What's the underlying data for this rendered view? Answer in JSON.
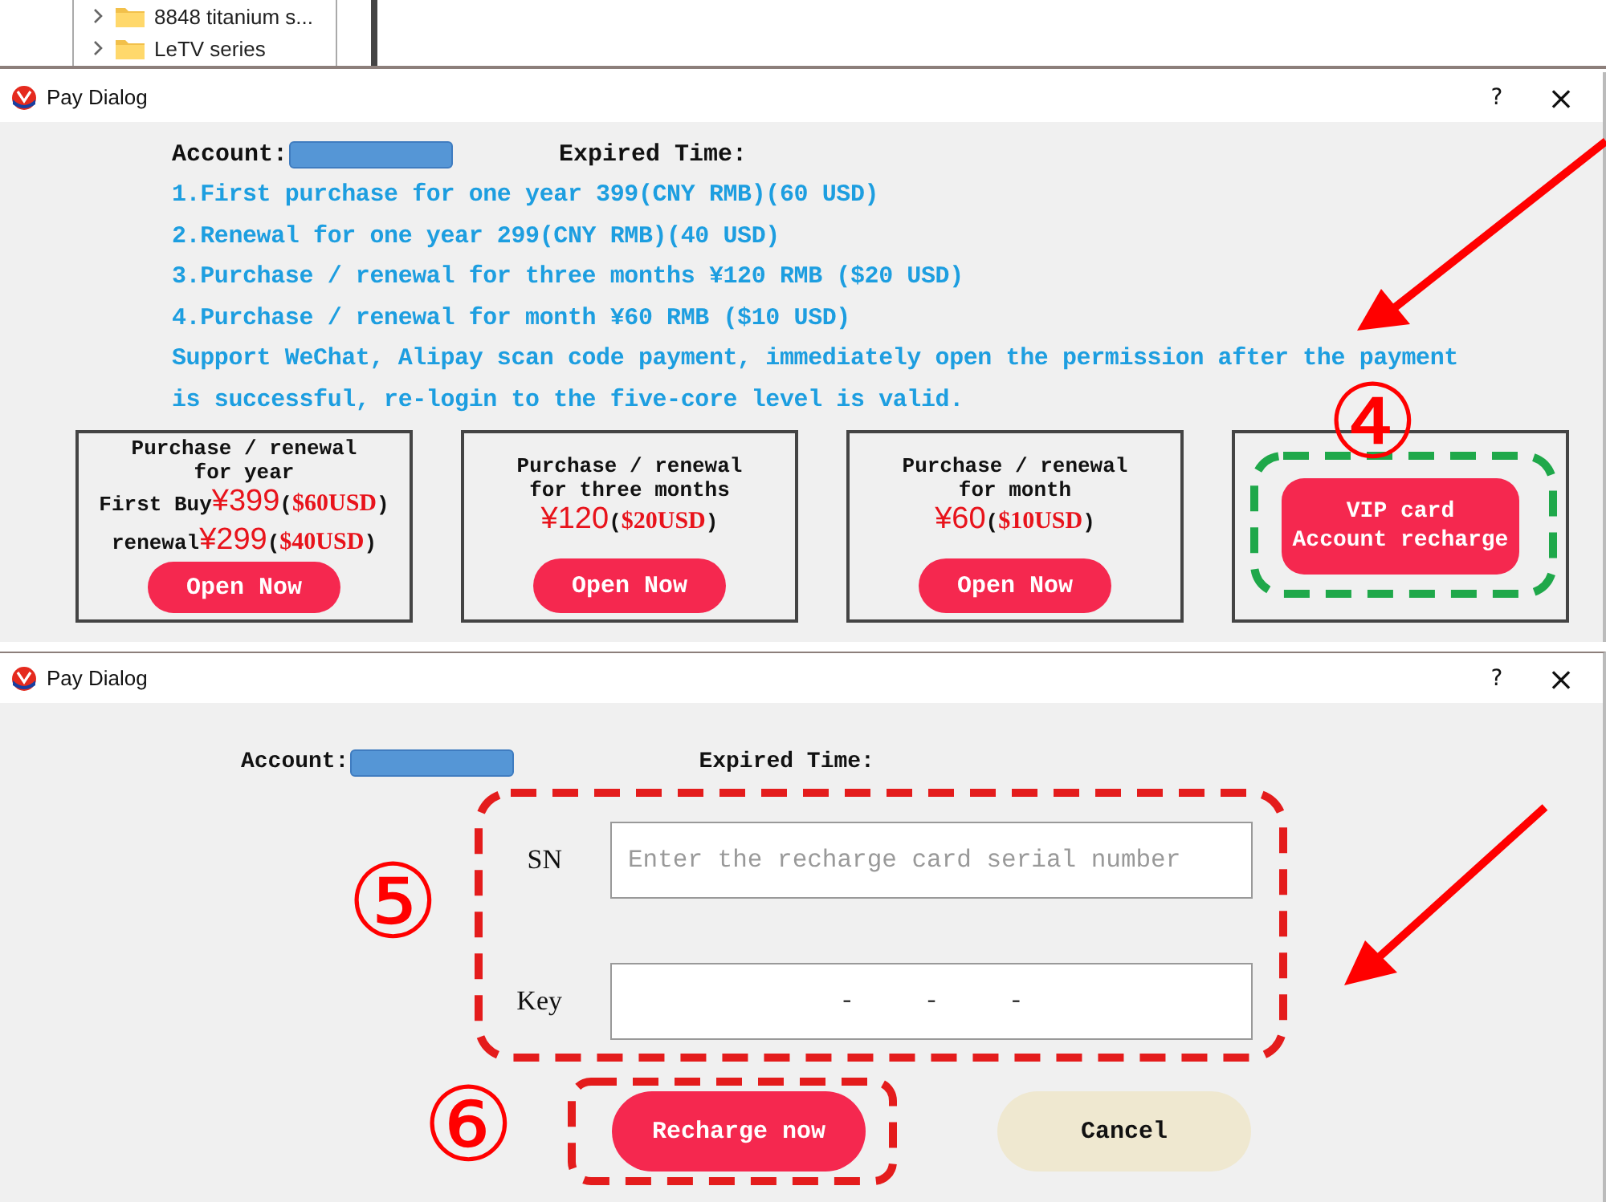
{
  "file_tree": {
    "items": [
      {
        "label": "8848 titanium s...",
        "expanded": false
      },
      {
        "label": "LeTV series",
        "expanded": false
      }
    ]
  },
  "plans_dialog": {
    "title": "Pay Dialog",
    "help": "?",
    "close": "×",
    "account_label": "Account:",
    "expired_label": "Expired Time:",
    "info_lines": [
      "1.First purchase for one year 399(CNY RMB)(60 USD)",
      "2.Renewal for one year 299(CNY RMB)(40 USD)",
      "3.Purchase / renewal for three months ¥120 RMB ($20 USD)",
      "4.Purchase / renewal for month ¥60 RMB ($10 USD)",
      "Support WeChat, Alipay scan code payment, immediately open the permission after the payment",
      "is successful, re-login to the five-core level is valid."
    ],
    "plans": [
      {
        "kind": "plan",
        "title_lines": [
          "Purchase / renewal",
          "for year"
        ],
        "price_lines": [
          {
            "label": "First Buy",
            "price": "¥399",
            "usd": "$60USD",
            "open": "(",
            "close": ")"
          },
          {
            "label": "renewal",
            "price": "¥299",
            "usd": "$40USD",
            "open": "(",
            "close": ")"
          }
        ],
        "button": "Open Now"
      },
      {
        "kind": "plan",
        "title_lines": [
          "Purchase / renewal",
          "for three months"
        ],
        "price_lines": [
          {
            "price": "¥120",
            "usd": "$20USD",
            "open": "(",
            "close": ")"
          }
        ],
        "button": "Open Now"
      },
      {
        "kind": "plan",
        "title_lines": [
          "Purchase / renewal",
          "for month"
        ],
        "price_lines": [
          {
            "price": "¥60",
            "usd": "$10USD",
            "open": "(",
            "close": ")"
          }
        ],
        "button": "Open Now"
      },
      {
        "kind": "card",
        "button": "VIP card\nAccount recharge"
      }
    ]
  },
  "recharge_dialog": {
    "title": "Pay Dialog",
    "help": "?",
    "close": "×",
    "account_label": "Account:",
    "expired_label": "Expired Time:",
    "fields": [
      {
        "label": "SN",
        "placeholder": "Enter the recharge card serial number"
      },
      {
        "label": "Key",
        "value": "- - -"
      }
    ],
    "buttons": [
      {
        "label": "Recharge now",
        "kind": "primary"
      },
      {
        "label": "Cancel",
        "kind": "secondary"
      }
    ]
  },
  "annotations": {
    "step_numbers": [
      "④",
      "⑤",
      "⑥"
    ]
  }
}
